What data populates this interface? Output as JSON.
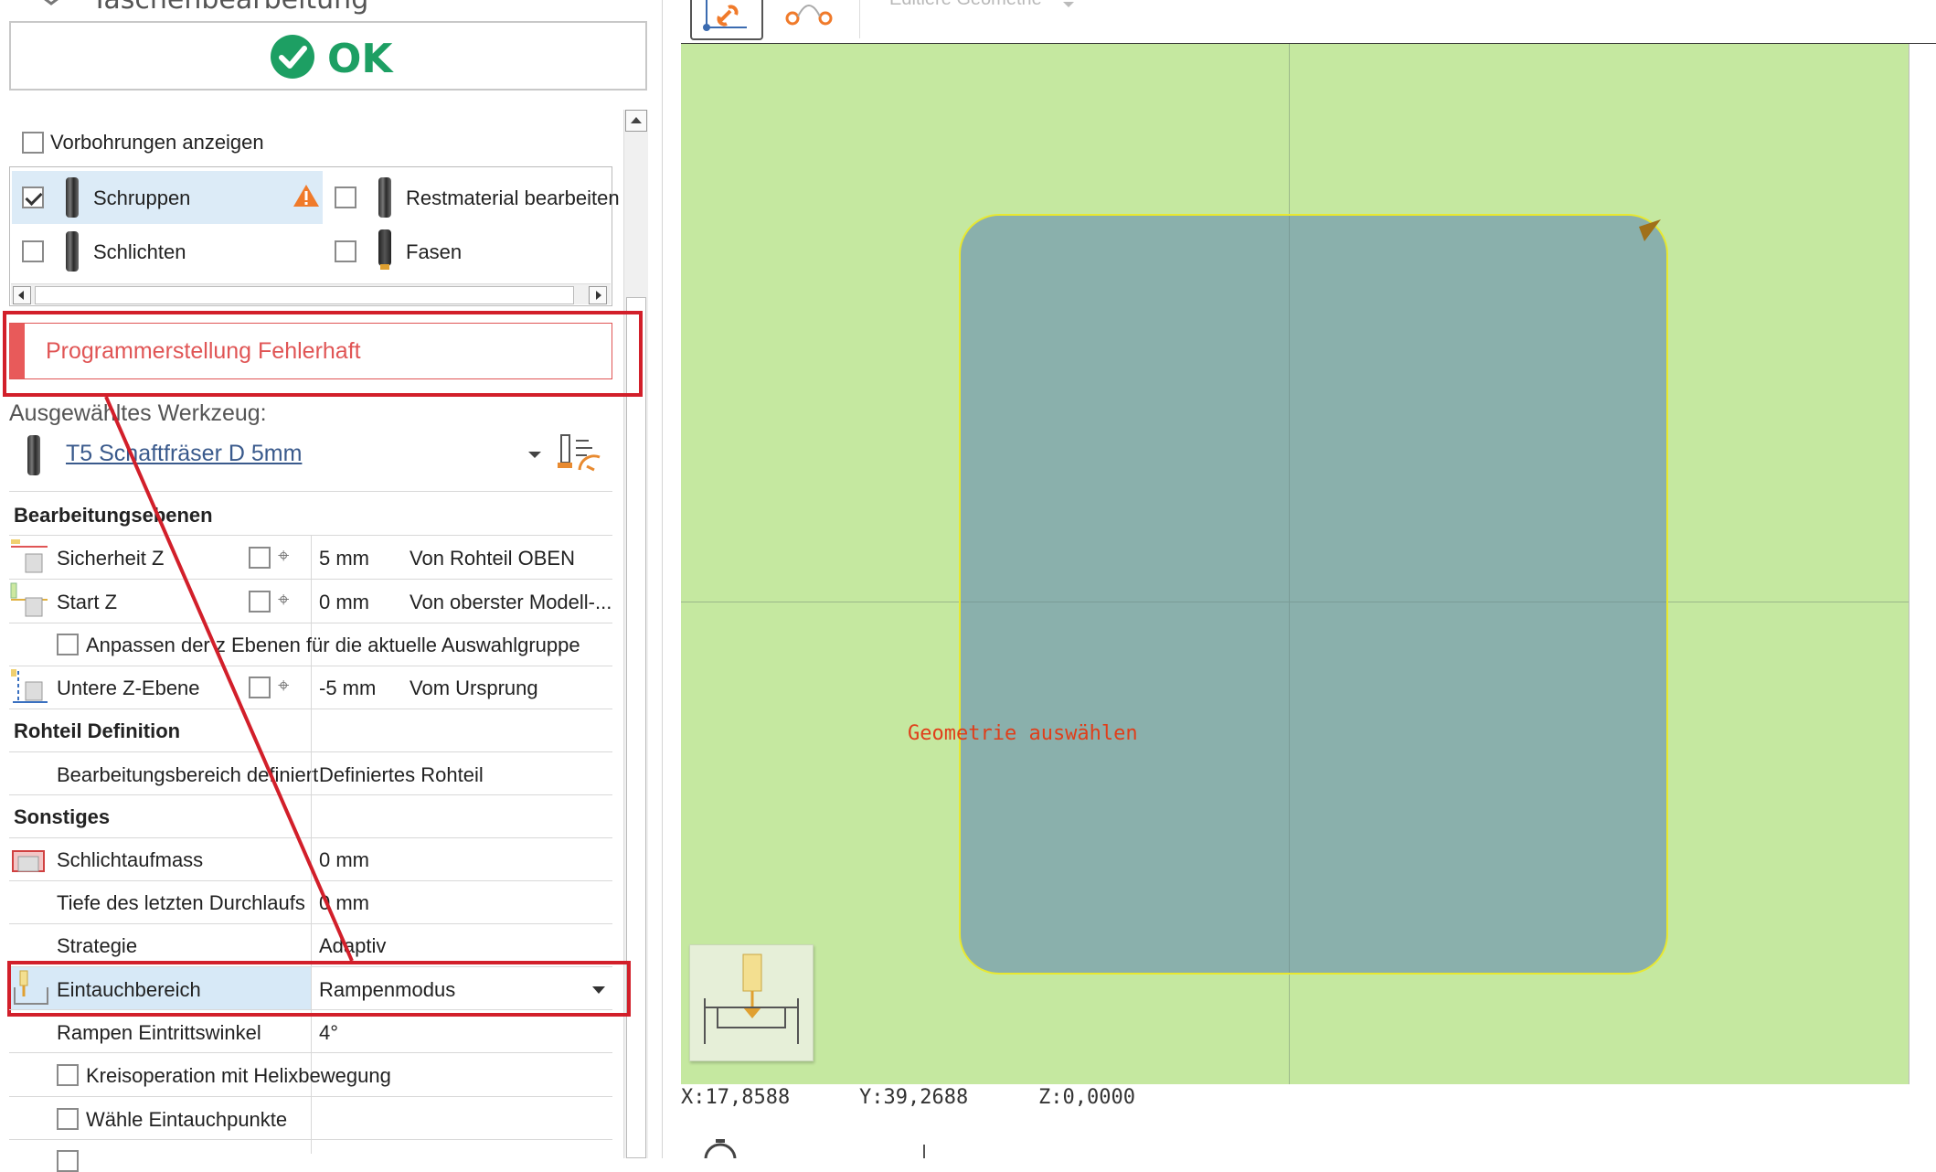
{
  "window": {
    "title_partial": "Taschenbearbeitung"
  },
  "ok_button": {
    "label": "OK"
  },
  "show_predrill": {
    "label": "Vorbohrungen anzeigen",
    "checked": false
  },
  "operations": [
    {
      "label": "Schruppen",
      "checked": true,
      "warning": true
    },
    {
      "label": "Restmaterial bearbeiten",
      "checked": false
    },
    {
      "label": "Schlichten",
      "checked": false
    },
    {
      "label": "Fasen",
      "checked": false
    }
  ],
  "error_banner": {
    "text": "Programmerstellung Fehlerhaft",
    "color": "#e05555"
  },
  "selected_tool": {
    "heading": "Ausgewähltes Werkzeug:",
    "name": "T5 Schaftfräser D 5mm"
  },
  "sections": {
    "planes": "Bearbeitungsebenen",
    "stock": "Rohteil Definition",
    "misc": "Sonstiges"
  },
  "properties": {
    "safety_z": {
      "label": "Sicherheit Z",
      "value": "5 mm",
      "ref": "Von Rohteil OBEN"
    },
    "start_z": {
      "label": "Start Z",
      "value": "0 mm",
      "ref": "Von oberster Modell-..."
    },
    "adjust_z": {
      "label": "Anpassen der z Ebenen für die aktuelle Auswahlgruppe"
    },
    "lower_z": {
      "label": "Untere Z-Ebene",
      "value": "-5 mm",
      "ref": "Vom Ursprung"
    },
    "machining_area": {
      "label": "Bearbeitungsbereich definiert",
      "value": "Definiertes Rohteil"
    },
    "finish_allowance": {
      "label": "Schlichtaufmass",
      "value": "0 mm"
    },
    "last_pass_depth": {
      "label": "Tiefe des letzten Durchlaufs",
      "value": "0 mm"
    },
    "strategy": {
      "label": "Strategie",
      "value": "Adaptiv"
    },
    "plunge": {
      "label": "Eintauchbereich",
      "value": "Rampenmodus"
    },
    "ramp_angle": {
      "label": "Rampen Eintrittswinkel",
      "value": "4°"
    },
    "helix": {
      "label": "Kreisoperation mit Helixbewegung"
    },
    "choose_plunge_points": {
      "label": "Wähle Eintauchpunkte"
    }
  },
  "viewport": {
    "toolbar_label": "Editiere Geometrie",
    "hint": "Geometrie auswählen",
    "background_color": "#c5e8a0",
    "pocket_color": "#8ab0ac"
  },
  "status": {
    "x": "X:17,8588",
    "y": "Y:39,2688",
    "z": "Z:0,0000"
  },
  "highlight_color": "#d21f2a",
  "icons": [
    "check-circle-icon",
    "warning-icon",
    "endmill-icon",
    "tool-settings-icon",
    "pointer-pick-icon",
    "dropdown-icon",
    "scroll-up-icon",
    "scroll-left-icon",
    "scroll-right-icon",
    "link-geometry-icon",
    "node-geometry-icon"
  ]
}
